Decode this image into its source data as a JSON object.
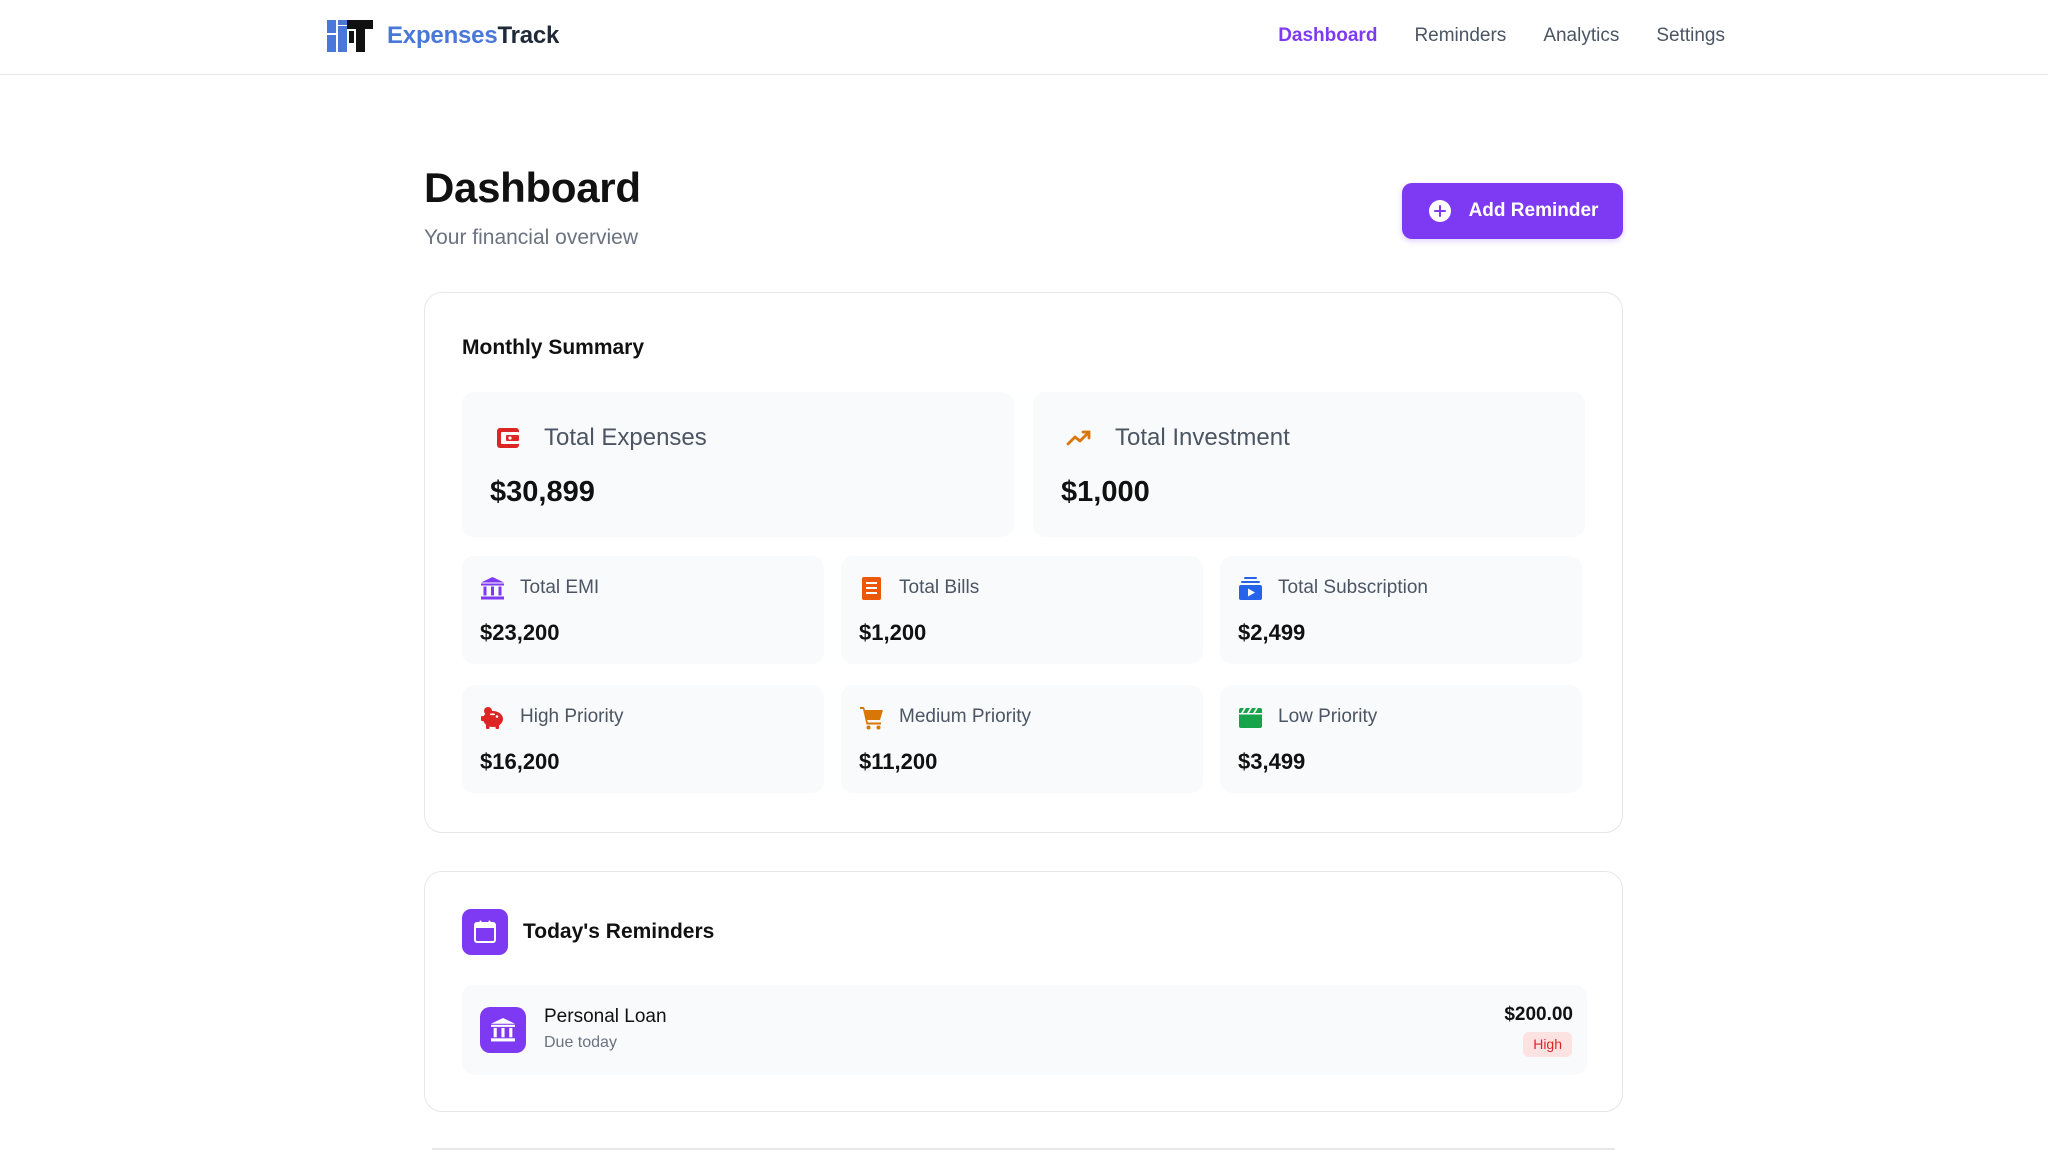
{
  "brand": {
    "name_part1": "Expenses",
    "name_part2": "Track"
  },
  "nav": {
    "items": [
      {
        "label": "Dashboard",
        "active": true
      },
      {
        "label": "Reminders",
        "active": false
      },
      {
        "label": "Analytics",
        "active": false
      },
      {
        "label": "Settings",
        "active": false
      }
    ]
  },
  "header": {
    "title": "Dashboard",
    "subtitle": "Your financial overview",
    "add_button_label": "Add Reminder"
  },
  "summary": {
    "title": "Monthly Summary",
    "big_stats": [
      {
        "label": "Total Expenses",
        "value": "$30,899",
        "icon": "wallet-icon",
        "color": "#dc2626"
      },
      {
        "label": "Total Investment",
        "value": "$1,000",
        "icon": "trending-up-icon",
        "color": "#d97706"
      }
    ],
    "small_stats": [
      {
        "label": "Total EMI",
        "value": "$23,200",
        "icon": "bank-icon",
        "color": "#7e3af2"
      },
      {
        "label": "Total Bills",
        "value": "$1,200",
        "icon": "receipt-icon",
        "color": "#ea580c"
      },
      {
        "label": "Total Subscription",
        "value": "$2,499",
        "icon": "subscription-icon",
        "color": "#2563eb"
      },
      {
        "label": "High Priority",
        "value": "$16,200",
        "icon": "piggy-bank-icon",
        "color": "#dc2626"
      },
      {
        "label": "Medium Priority",
        "value": "$11,200",
        "icon": "shopping-cart-icon",
        "color": "#d97706"
      },
      {
        "label": "Low Priority",
        "value": "$3,499",
        "icon": "clapperboard-icon",
        "color": "#16a34a"
      }
    ]
  },
  "reminders": {
    "title": "Today's Reminders",
    "items": [
      {
        "name": "Personal Loan",
        "due": "Due today",
        "amount": "$200.00",
        "priority": "High"
      }
    ]
  },
  "colors": {
    "accent": "#7e3af2",
    "brand_blue": "#4a78d9",
    "high_badge_bg": "#fde2e2",
    "high_badge_text": "#dc2626"
  }
}
